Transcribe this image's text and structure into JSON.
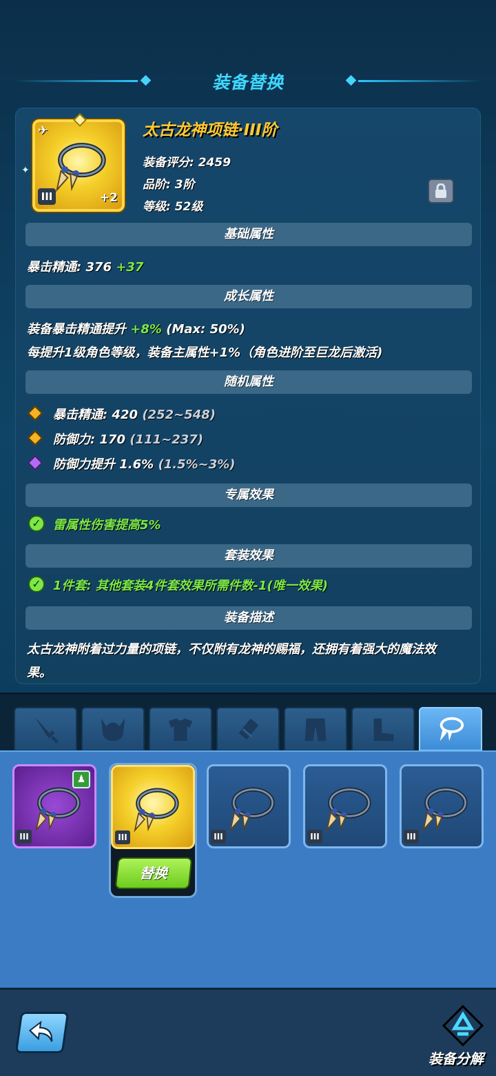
{
  "title": "装备替换",
  "item": {
    "name": "太古龙神项链·III阶",
    "tier_label": "III",
    "enhance": "+2",
    "score": "装备评分: 2459",
    "grade": "品阶: 3阶",
    "level": "等级: 52级"
  },
  "sections": {
    "base": "基础属性",
    "growth": "成长属性",
    "random": "随机属性",
    "exclusive": "专属效果",
    "set": "套装效果",
    "desc": "装备描述"
  },
  "base_stat": {
    "label": "暴击精通: 376",
    "bonus": "+37"
  },
  "growth": {
    "line1_prefix": "装备暴击精通提升",
    "line1_value": "+8%",
    "line1_suffix": "(Max: 50%)",
    "line2": "每提升1级角色等级，装备主属性+1%（角色进阶至巨龙后激活)"
  },
  "random_stats": [
    {
      "label": "暴击精通: 420",
      "range": "(252~548)",
      "rarity": "gold"
    },
    {
      "label": "防御力: 170",
      "range": "(111~237)",
      "rarity": "gold"
    },
    {
      "label": "防御力提升 1.6%",
      "range": "(1.5%~3%)",
      "rarity": "purple"
    }
  ],
  "exclusive_effect": "雷属性伤害提高5%",
  "set_effect": "1件套: 其他套装4件套效果所需件数-1(唯一效果)",
  "description": {
    "line1": "太古龙神附着过力量的项链，不仅附有龙神的赐福，还拥有着强大的魔法效",
    "line2": "果。"
  },
  "tabs": [
    "weapon",
    "helmet",
    "armor",
    "bracer",
    "pants",
    "boots",
    "necklace"
  ],
  "inventory": {
    "slots": [
      {
        "tier": "III",
        "rarity": "purple"
      },
      {
        "tier": "III",
        "rarity": "gold"
      },
      {
        "tier": "III",
        "rarity": "blue"
      },
      {
        "tier": "III",
        "rarity": "blue"
      },
      {
        "tier": "III",
        "rarity": "blue"
      }
    ],
    "replace_label": "替换"
  },
  "footer": {
    "decompose_label": "装备分解"
  },
  "colors": {
    "accent": "#3fd8ff",
    "name_gold": "#ffc933",
    "green": "#7be848",
    "purple": "#b36af7"
  }
}
